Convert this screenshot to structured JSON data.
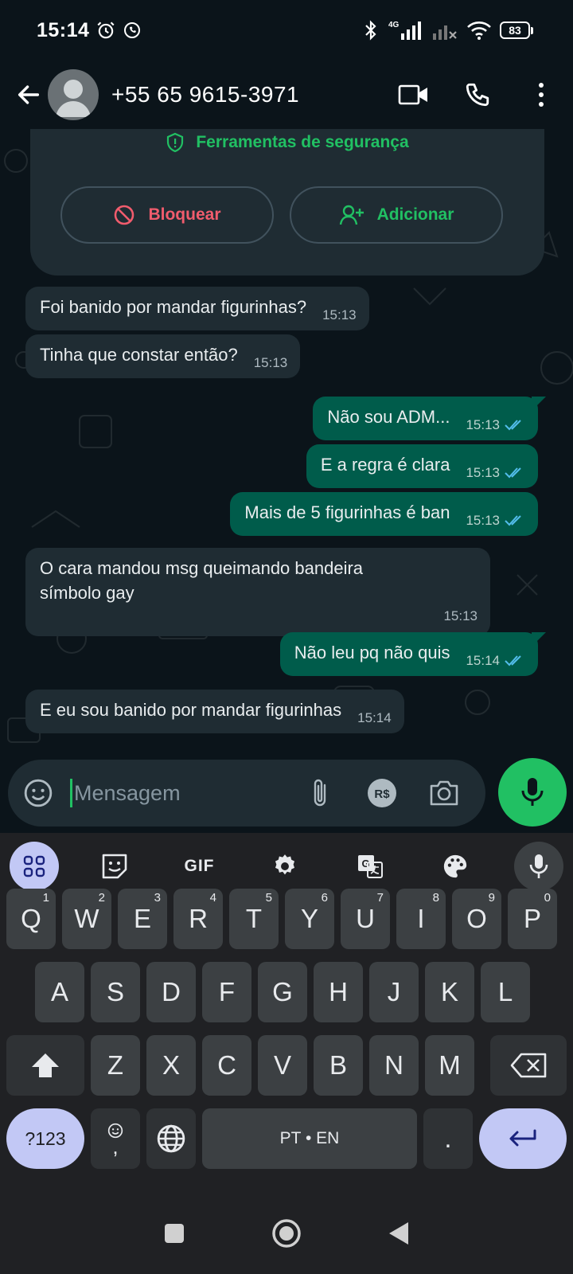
{
  "status": {
    "time": "15:14",
    "network": "4G",
    "battery": "83"
  },
  "header": {
    "contact": "+55 65 9615-3971"
  },
  "security": {
    "title": "Ferramentas de segurança",
    "block_label": "Bloquear",
    "add_label": "Adicionar"
  },
  "messages": [
    {
      "dir": "in",
      "text": "Foi banido por mandar figurinhas?",
      "time": "15:13"
    },
    {
      "dir": "in",
      "text": "Tinha que constar então?",
      "time": "15:13"
    },
    {
      "dir": "out",
      "text": "Não sou ADM...",
      "time": "15:13"
    },
    {
      "dir": "out",
      "text": "E a regra é clara",
      "time": "15:13"
    },
    {
      "dir": "out",
      "text": "Mais de 5 figurinhas é ban",
      "time": "15:13"
    },
    {
      "dir": "in",
      "text": "O cara mandou msg queimando bandeira símbolo gay",
      "time": "15:13"
    },
    {
      "dir": "out",
      "text": "Não leu pq não quis",
      "time": "15:14"
    },
    {
      "dir": "in",
      "text": "E eu sou banido por mandar figurinhas",
      "time": "15:14"
    }
  ],
  "composer": {
    "placeholder": "Mensagem",
    "currency_label": "R$"
  },
  "keyboard": {
    "gif_label": "GIF",
    "row1": [
      {
        "k": "Q",
        "n": "1"
      },
      {
        "k": "W",
        "n": "2"
      },
      {
        "k": "E",
        "n": "3"
      },
      {
        "k": "R",
        "n": "4"
      },
      {
        "k": "T",
        "n": "5"
      },
      {
        "k": "Y",
        "n": "6"
      },
      {
        "k": "U",
        "n": "7"
      },
      {
        "k": "I",
        "n": "8"
      },
      {
        "k": "O",
        "n": "9"
      },
      {
        "k": "P",
        "n": "0"
      }
    ],
    "row2": [
      "A",
      "S",
      "D",
      "F",
      "G",
      "H",
      "J",
      "K",
      "L"
    ],
    "row3": [
      "Z",
      "X",
      "C",
      "V",
      "B",
      "N",
      "M"
    ],
    "sym_label": "?123",
    "comma_label": ",",
    "space_label": "PT • EN",
    "period_label": "."
  },
  "colors": {
    "accent": "#21c063",
    "outgoing": "#005c4b",
    "incoming": "#1f2c33",
    "danger": "#f15c6d",
    "background": "#0b141a",
    "read_ticks": "#53bdeb"
  },
  "icons": [
    "back-arrow-icon",
    "video-call-icon",
    "phone-icon",
    "more-vert-icon",
    "shield-icon",
    "block-icon",
    "add-person-icon",
    "emoji-icon",
    "attach-icon",
    "currency-icon",
    "camera-icon",
    "mic-icon",
    "double-check-icon"
  ]
}
